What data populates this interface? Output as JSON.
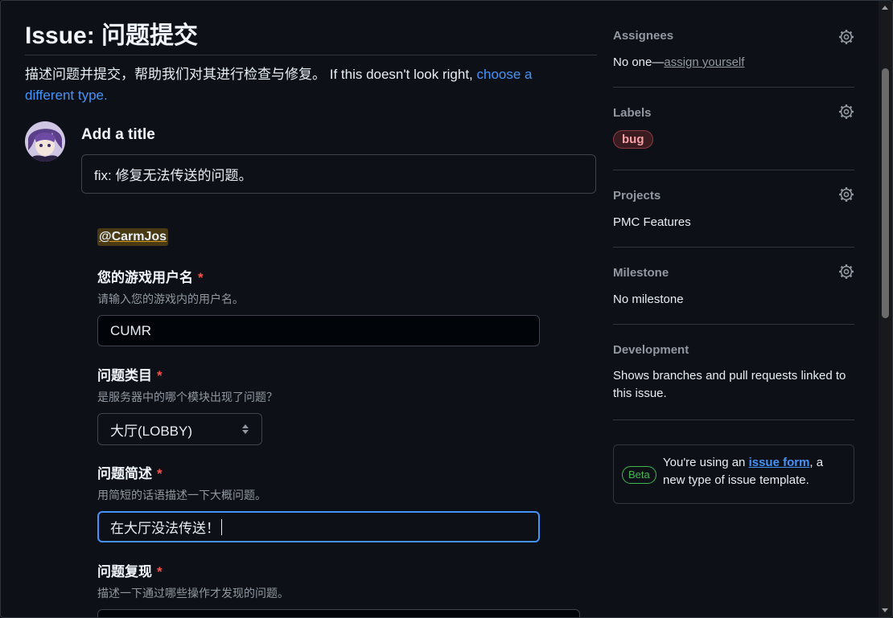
{
  "page": {
    "title": "Issue: 问题提交",
    "description_text": "描述问题并提交，帮助我们对其进行检查与修复。 If this doesn't look right, ",
    "description_link": "choose a different type."
  },
  "title_section": {
    "label": "Add a title",
    "value": "fix: 修复无法传送的问题。"
  },
  "form": {
    "mention": "@CarmJos",
    "fields": [
      {
        "label": "您的游戏用户名",
        "required": "*",
        "hint": "请输入您的游戏内的用户名。",
        "value": "CUMR"
      },
      {
        "label": "问题类目",
        "required": "*",
        "hint": "是服务器中的哪个模块出现了问题？",
        "value": "大厅(LOBBY)"
      },
      {
        "label": "问题简述",
        "required": "*",
        "hint": "用简短的话语描述一下大概问题。",
        "value": "在大厅没法传送！"
      },
      {
        "label": "问题复现",
        "required": "*",
        "hint": "描述一下通过哪些操作才发现的问题。",
        "value": ""
      }
    ]
  },
  "sidebar": {
    "assignees": {
      "heading": "Assignees",
      "value": "No one—",
      "link": "assign yourself"
    },
    "labels": {
      "heading": "Labels",
      "items": [
        "bug"
      ]
    },
    "projects": {
      "heading": "Projects",
      "value": "PMC Features"
    },
    "milestone": {
      "heading": "Milestone",
      "value": "No milestone"
    },
    "development": {
      "heading": "Development",
      "value": "Shows branches and pull requests linked to this issue."
    },
    "beta": {
      "badge": "Beta",
      "text_before": "You're using an ",
      "link": "issue form",
      "text_after": ", a new type of issue template."
    }
  },
  "colors": {
    "accent": "#4493f8",
    "danger": "#f85149",
    "beta": "#3fb950",
    "background": "#0d1117"
  },
  "icons": [
    "gear-icon",
    "updown-icon",
    "avatar"
  ]
}
